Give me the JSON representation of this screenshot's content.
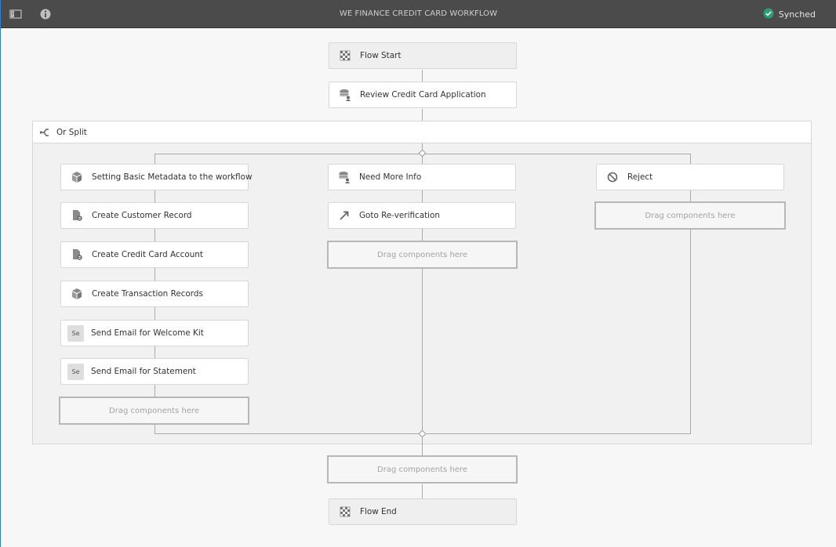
{
  "header": {
    "title": "WE FINANCE CREDIT CARD WORKFLOW",
    "sync_label": "Synched",
    "icons": {
      "sidebar": "sidebar-toggle-icon",
      "info": "info-icon",
      "sync": "check-circle-icon"
    }
  },
  "colors": {
    "topbar": "#4b4b4b",
    "sync_green": "#2d9d78",
    "accent_edge": "#2a7fd6",
    "connector": "#a8a8a8"
  },
  "workflow": {
    "start": {
      "label": "Flow Start",
      "icon": "checkered-flag-icon"
    },
    "review": {
      "label": "Review Credit Card Application",
      "icon": "participant-step-icon"
    },
    "split": {
      "label": "Or Split",
      "icon": "split-icon"
    },
    "branches": [
      {
        "steps": [
          {
            "label": "Setting Basic Metadata to the workflow",
            "icon": "process-box-icon"
          },
          {
            "label": "Create Customer Record",
            "icon": "document-process-icon"
          },
          {
            "label": "Create Credit Card Account",
            "icon": "document-process-icon"
          },
          {
            "label": "Create Transaction Records",
            "icon": "process-box-icon"
          },
          {
            "label": "Send Email for Welcome Kit",
            "icon_text": "Se"
          },
          {
            "label": "Send Email for Statement",
            "icon_text": "Se"
          }
        ],
        "drop_label": "Drag components here"
      },
      {
        "steps": [
          {
            "label": "Need More Info",
            "icon": "participant-step-icon"
          },
          {
            "label": "Goto Re-verification",
            "icon": "goto-arrow-icon"
          }
        ],
        "drop_label": "Drag components here"
      },
      {
        "steps": [
          {
            "label": "Reject",
            "icon": "no-entry-icon"
          }
        ],
        "drop_label": "Drag components here"
      }
    ],
    "after_split_drop_label": "Drag components here",
    "end": {
      "label": "Flow End",
      "icon": "checkered-flag-icon"
    }
  }
}
